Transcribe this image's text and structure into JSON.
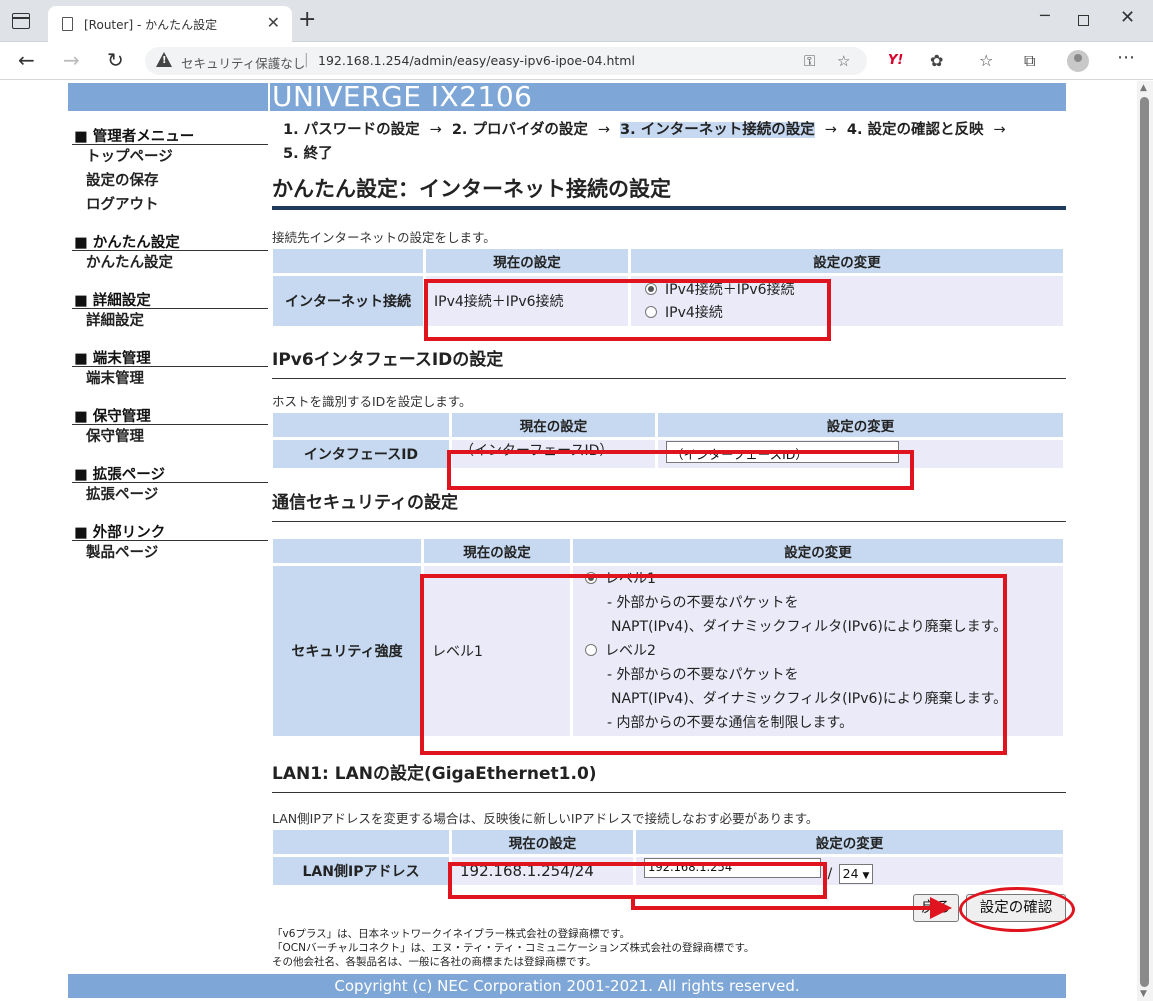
{
  "browser": {
    "tab_title": "[Router] - かんたん設定",
    "tab_close": "✕",
    "new_tab": "+",
    "security_label": "セキュリティ保護なし",
    "url": "192.168.1.254/admin/easy/easy-ipv6-ipoe-04.html",
    "yahoo_label": "Y!"
  },
  "header": {
    "brand": "UNIVERGE IX2106"
  },
  "sidebar": {
    "sections": [
      {
        "title": "■ 管理者メニュー",
        "items": [
          "トップページ",
          "設定の保存",
          "ログアウト"
        ]
      },
      {
        "title": "■ かんたん設定",
        "items": [
          "かんたん設定"
        ]
      },
      {
        "title": "■ 詳細設定",
        "items": [
          "詳細設定"
        ]
      },
      {
        "title": "■ 端末管理",
        "items": [
          "端末管理"
        ]
      },
      {
        "title": "■ 保守管理",
        "items": [
          "保守管理"
        ]
      },
      {
        "title": "■ 拡張ページ",
        "items": [
          "拡張ページ"
        ]
      },
      {
        "title": "■ 外部リンク",
        "items": [
          "製品ページ"
        ]
      }
    ]
  },
  "steps": {
    "s1": "1. パスワードの設定",
    "s2": "2. プロバイダの設定",
    "s3": "3. インターネット接続の設定",
    "s4": "4. 設定の確認と反映",
    "s5": "5. 終了",
    "arrow": "→"
  },
  "page_title": "かんたん設定：インターネット接続の設定",
  "internet": {
    "desc": "接続先インターネットの設定をします。",
    "col_current": "現在の設定",
    "col_change": "設定の変更",
    "label": "インターネット接続",
    "current": "IPv4接続＋IPv6接続",
    "option1": "IPv4接続＋IPv6接続",
    "option2": "IPv4接続",
    "selected": 1
  },
  "ipv6": {
    "heading": "IPv6インタフェースIDの設定",
    "desc": "ホストを識別するIDを設定します。",
    "col_current": "現在の設定",
    "col_change": "設定の変更",
    "label": "インタフェースID",
    "current": "（インターフェースID）",
    "input_value": "（インターフェースID）"
  },
  "security": {
    "heading": "通信セキュリティの設定",
    "col_current": "現在の設定",
    "col_change": "設定の変更",
    "label": "セキュリティ強度",
    "current": "レベル1",
    "level1": "レベル1",
    "level1_line1": "- 外部からの不要なパケットを",
    "level1_line2": "NAPT(IPv4)、ダイナミックフィルタ(IPv6)により廃棄します。",
    "level2": "レベル2",
    "level2_line1": "- 外部からの不要なパケットを",
    "level2_line2": "NAPT(IPv4)、ダイナミックフィルタ(IPv6)により廃棄します。",
    "level2_line3": "- 内部からの不要な通信を制限します。",
    "selected": 1
  },
  "lan": {
    "heading": "LAN1: LANの設定(GigaEthernet1.0)",
    "desc": "LAN側IPアドレスを変更する場合は、反映後に新しいIPアドレスで接続しなおす必要があります。",
    "col_current": "現在の設定",
    "col_change": "設定の変更",
    "label": "LAN側IPアドレス",
    "current": "192.168.1.254/24",
    "input_value": "192.168.1.254",
    "slash": "/",
    "prefix": "24"
  },
  "buttons": {
    "back": "戻る",
    "confirm": "設定の確認"
  },
  "trademarks": {
    "line1": "「v6プラス」は、日本ネットワークイネイブラー株式会社の登録商標です。",
    "line2": "「OCNバーチャルコネクト」は、エヌ・ティ・ティ・コミュニケーションズ株式会社の登録商標です。",
    "line3": "その他会社名、各製品名は、一般に各社の商標または登録商標です。"
  },
  "footer": "Copyright (c) NEC Corporation 2001-2021. All rights reserved.",
  "colors": {
    "accent": "#7ea6d6",
    "header_cell": "#c6d9f1",
    "value_cell": "#eaeaf8",
    "annotation": "#e0141e"
  }
}
